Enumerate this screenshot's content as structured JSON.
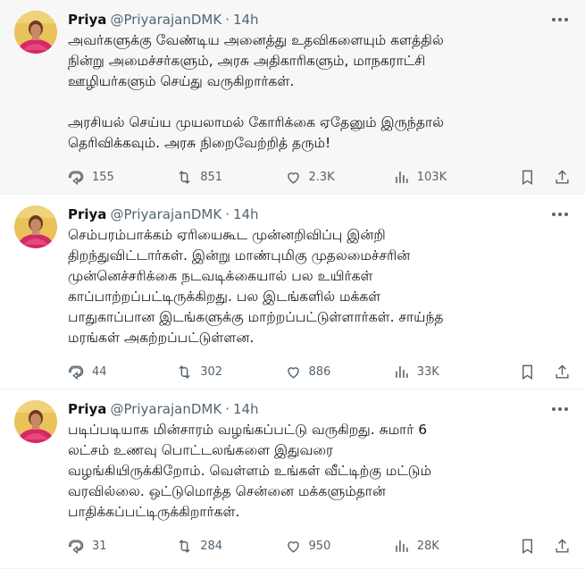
{
  "tweets": [
    {
      "name": "Priya",
      "handle": "@PriyarajanDMK",
      "separator": "·",
      "time": "14h",
      "text": "அவர்களுக்கு வேண்டிய அனைத்து உதவிகளையும் களத்தில்\nநின்று அமைச்சர்களும், அரசு அதிகாரிகளும், மாநகராட்சி\nஊழியர்களும் செய்து வருகிறார்கள்.\n\nஅரசியல் செய்ய முயலாமல் கோரிக்கை ஏதேனும் இருந்தால்\nதெரிவிக்கவும். அரசு நிறைவேற்றித் தரும்!",
      "replies": "155",
      "retweets": "851",
      "likes": "2.3K",
      "views": "103K"
    },
    {
      "name": "Priya",
      "handle": "@PriyarajanDMK",
      "separator": "·",
      "time": "14h",
      "text": "செம்பரம்பாக்கம் ஏரியைகூட முன்னறிவிப்பு இன்றி\nதிறந்துவிட்டார்கள். இன்று மாண்புமிகு முதலமைச்சரின்\nமுன்னெச்சரிக்கை நடவடிக்கையால் பல உயிர்கள்\nகாப்பாற்றப்பட்டிருக்கிறது. பல இடங்களில் மக்கள்\nபாதுகாப்பான இடங்களுக்கு மாற்றப்பட்டுள்ளார்கள். சாய்ந்த\nமரங்கள் அகற்றப்பட்டுள்ளன.",
      "replies": "44",
      "retweets": "302",
      "likes": "886",
      "views": "33K"
    },
    {
      "name": "Priya",
      "handle": "@PriyarajanDMK",
      "separator": "·",
      "time": "14h",
      "text": "படிப்படியாக மின்சாரம் வழங்கப்பட்டு வருகிறது. சுமார் 6\nலட்சம் உணவு பொட்டலங்களை இதுவரை\nவழங்கியிருக்கிறோம். வெள்ளம் உங்கள் வீட்டிற்கு மட்டும்\nவரவில்லை. ஒட்டுமொத்த சென்னை மக்களும்தான்\nபாதிக்கப்பட்டிருக்கிறார்கள்.",
      "replies": "31",
      "retweets": "284",
      "likes": "950",
      "views": "28K"
    }
  ],
  "colors": {
    "text": "#0f1419",
    "muted": "#536471",
    "divider": "#eff3f4",
    "hover_bg": "#f7f7f7"
  },
  "icons": [
    "reply-icon",
    "retweet-icon",
    "like-icon",
    "views-icon",
    "bookmark-icon",
    "share-icon",
    "more-icon"
  ]
}
